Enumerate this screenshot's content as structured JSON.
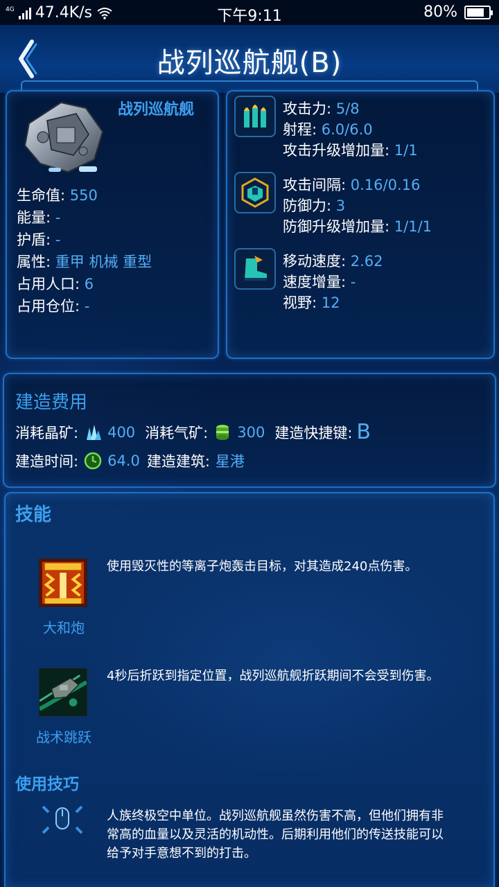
{
  "status_bar": {
    "network": "4G",
    "speed": "47.4K/s",
    "time": "下午9:11",
    "battery": "80%",
    "battery_level": 0.8
  },
  "header": {
    "title": "战列巡航舰(B)",
    "back_icon": "chevron-left-icon"
  },
  "unit": {
    "name": "战列巡航舰",
    "stats": [
      {
        "label": "生命值:",
        "value": "550"
      },
      {
        "label": "能量:",
        "value": "-"
      },
      {
        "label": "护盾:",
        "value": "-"
      },
      {
        "label": "属性:",
        "value": "重甲 机械 重型"
      },
      {
        "label": "占用人口:",
        "value": "6"
      },
      {
        "label": "占用仓位:",
        "value": "-"
      }
    ]
  },
  "combat": {
    "attack": [
      {
        "label": "攻击力:",
        "value": "5/8"
      },
      {
        "label": "射程:",
        "value": "6.0/6.0"
      },
      {
        "label": "攻击升级增加量:",
        "value": "1/1"
      }
    ],
    "defense": [
      {
        "label": "攻击间隔:",
        "value": "0.16/0.16"
      },
      {
        "label": "防御力:",
        "value": "3"
      },
      {
        "label": "防御升级增加量:",
        "value": "1/1/1"
      }
    ],
    "movement": [
      {
        "label": "移动速度:",
        "value": "2.62"
      },
      {
        "label": "速度增量:",
        "value": "-"
      },
      {
        "label": "视野:",
        "value": "12"
      }
    ]
  },
  "cost": {
    "title": "建造费用",
    "mineral_label": "消耗晶矿:",
    "mineral_value": "400",
    "gas_label": "消耗气矿:",
    "gas_value": "300",
    "hotkey_label": "建造快捷键:",
    "hotkey_value": "B",
    "time_label": "建造时间:",
    "time_value": "64.0",
    "building_label": "建造建筑:",
    "building_value": "星港"
  },
  "skills": {
    "title": "技能",
    "items": [
      {
        "name": "大和炮",
        "desc": "使用毁灭性的等离子炮轰击目标，对其造成240点伤害。"
      },
      {
        "name": "战术跳跃",
        "desc": "4秒后折跃到指定位置，战列巡航舰折跃期间不会受到伤害。"
      }
    ],
    "tips_title": "使用技巧",
    "tips_lines": [
      "人族终极空中单位。战列巡航舰虽然伤害不高，但他们拥有非",
      "常高的血量以及灵活的机动性。后期利用他们的传送技能可以",
      "给予对手意想不到的打击。"
    ]
  },
  "colors": {
    "accent": "#3e9ff0",
    "value": "#55aef5",
    "panel_border": "#1f6fc4"
  }
}
